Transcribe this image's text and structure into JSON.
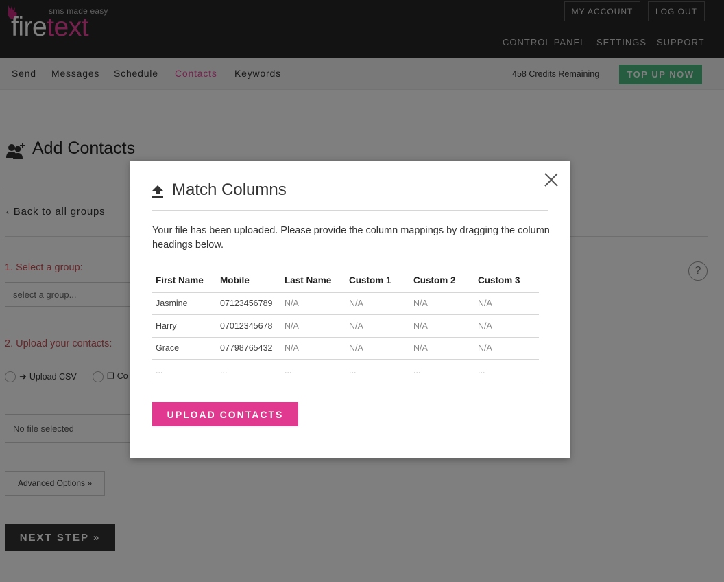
{
  "header": {
    "logo_tagline": "sms made easy",
    "logo_word_1": "fire",
    "logo_word_2": "text",
    "my_account_label": "MY ACCOUNT",
    "log_out_label": "LOG OUT",
    "nav": [
      "CONTROL PANEL",
      "SETTINGS",
      "SUPPORT"
    ]
  },
  "subnav": {
    "items": [
      "Send",
      "Messages",
      "Schedule",
      "Contacts",
      "Keywords"
    ],
    "active": "Contacts",
    "credits_text": "458 Credits Remaining",
    "top_up_label": "TOP UP NOW"
  },
  "page": {
    "title": "Add Contacts",
    "back_link": "Back to all groups",
    "step1_label": "1. Select a group:",
    "group_select_placeholder": "select a group...",
    "step2_label": "2. Upload your contacts:",
    "upload_options": [
      "Upload CSV",
      "Co"
    ],
    "file_status": "No file selected",
    "advanced_options_label": "Advanced Options »",
    "next_step_label": "NEXT STEP »",
    "help_label": "?"
  },
  "modal": {
    "title": "Match Columns",
    "description": "Your file has been uploaded. Please provide the column mappings by dragging the column headings below.",
    "columns": [
      "First Name",
      "Mobile",
      "Last Name",
      "Custom 1",
      "Custom 2",
      "Custom 3"
    ],
    "rows": [
      [
        "Jasmine",
        "07123456789",
        "N/A",
        "N/A",
        "N/A",
        "N/A"
      ],
      [
        "Harry",
        "07012345678",
        "N/A",
        "N/A",
        "N/A",
        "N/A"
      ],
      [
        "Grace",
        "07798765432",
        "N/A",
        "N/A",
        "N/A",
        "N/A"
      ],
      [
        "...",
        "...",
        "...",
        "...",
        "...",
        "..."
      ]
    ],
    "upload_button_label": "UPLOAD CONTACTS"
  },
  "colors": {
    "brand_pink": "#e8459a",
    "top_up_green": "#4cb87f",
    "step_red": "#c94f55",
    "upload_pink": "#e0398f"
  }
}
